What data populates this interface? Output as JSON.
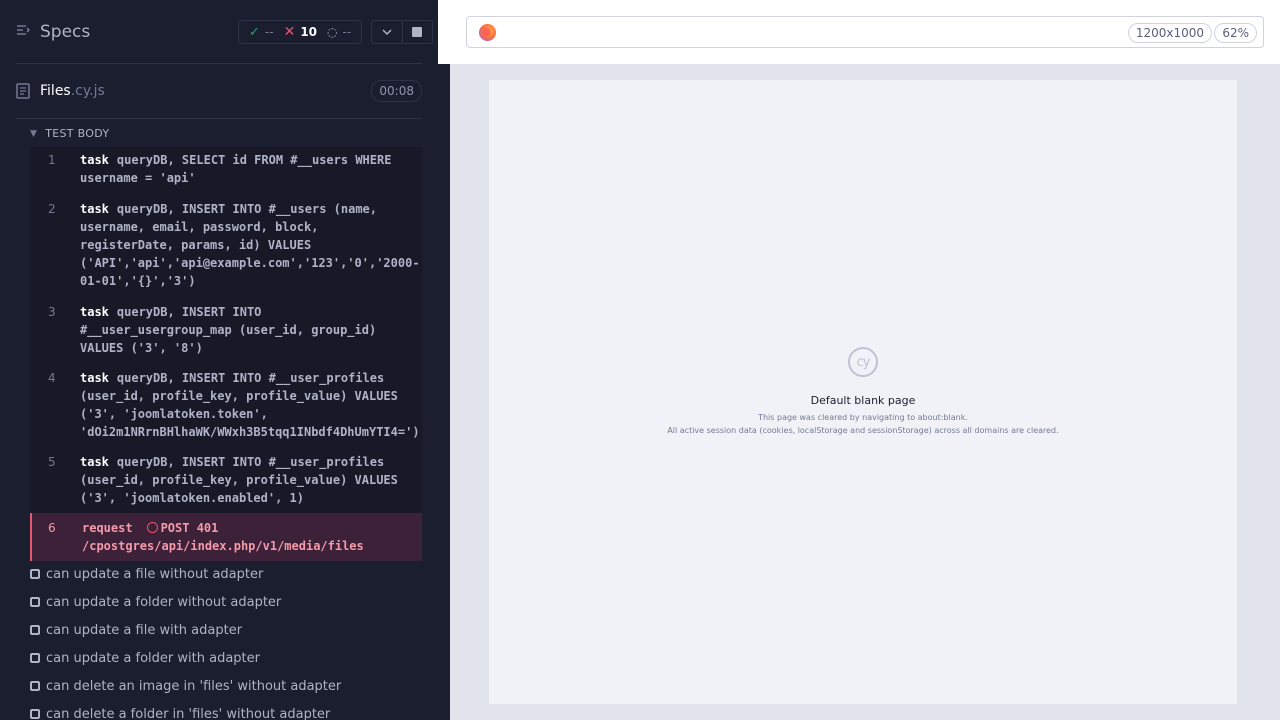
{
  "reporter": {
    "header": {
      "title": "Specs",
      "stats": {
        "passed": "--",
        "failed": "10",
        "pending": "--"
      }
    },
    "file": {
      "name": "Files",
      "ext": ".cy.js",
      "duration": "00:08"
    },
    "test_body_label": "TEST BODY",
    "commands": [
      {
        "num": "1",
        "name": "task",
        "message": "queryDB, SELECT id FROM #__users WHERE username = 'api'"
      },
      {
        "num": "2",
        "name": "task",
        "message": "queryDB, INSERT INTO #__users (name, username, email, password, block, registerDate, params, id) VALUES ('API','api','api@example.com','123','0','2000-01-01','{}','3')"
      },
      {
        "num": "3",
        "name": "task",
        "message": "queryDB, INSERT INTO #__user_usergroup_map (user_id, group_id) VALUES ('3', '8')"
      },
      {
        "num": "4",
        "name": "task",
        "message": "queryDB, INSERT INTO #__user_profiles (user_id, profile_key, profile_value) VALUES ('3', 'joomlatoken.token', 'dOi2m1NRrnBHlhaWK/WWxh3B5tqq1INbdf4DhUmYTI4=')"
      },
      {
        "num": "5",
        "name": "task",
        "message": "queryDB, INSERT INTO #__user_profiles (user_id, profile_key, profile_value) VALUES ('3', 'joomlatoken.enabled', 1)"
      },
      {
        "num": "6",
        "name": "request",
        "message": "POST 401 /cpostgres/api/index.php/v1/media/files"
      }
    ],
    "tests": [
      "can update a file without adapter",
      "can update a folder without adapter",
      "can update a file with adapter",
      "can update a folder with adapter",
      "can delete an image in 'files' without adapter",
      "can delete a folder in 'files' without adapter"
    ]
  },
  "aut": {
    "viewport_size": "1200x1000",
    "zoom": "62%",
    "blank_page": {
      "logo_text": "cy",
      "title": "Default blank page",
      "line1": "This page was cleared by navigating to about:blank.",
      "line2": "All active session data (cookies, localStorage and sessionStorage) across all domains are cleared."
    }
  }
}
